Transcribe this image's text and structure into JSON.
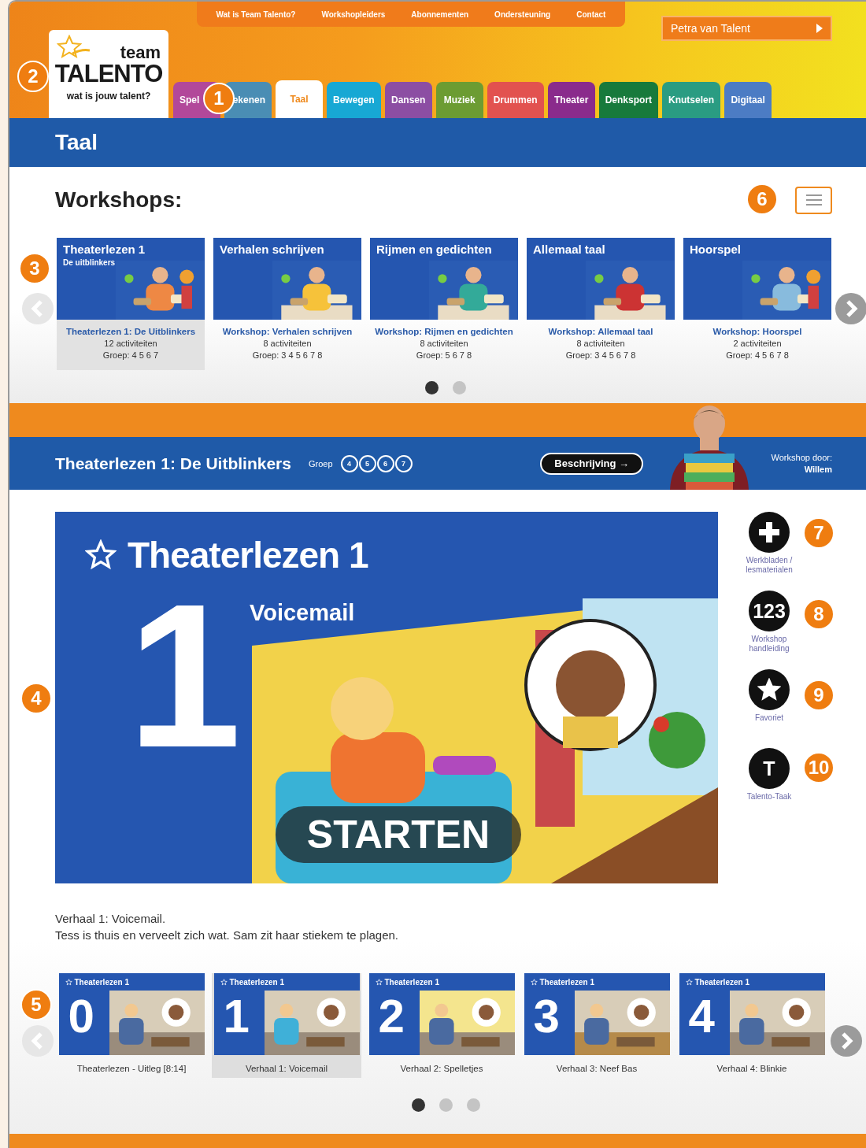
{
  "top_nav": [
    "Wat is Team Talento?",
    "Workshopleiders",
    "Abonnementen",
    "Ondersteuning",
    "Contact"
  ],
  "user_menu": {
    "label": "Petra van Talent"
  },
  "logo": {
    "word1": "team",
    "word2": "TALENTO",
    "tagline": "wat is jouw talent?"
  },
  "tabs": [
    {
      "label": "Spel",
      "color": "#b2489a",
      "selected": false
    },
    {
      "label": "ekenen",
      "color": "#4a8db4",
      "selected": false
    },
    {
      "label": "Taal",
      "color": "#ef8a1e",
      "selected": true
    },
    {
      "label": "Bewegen",
      "color": "#17a8d4",
      "selected": false
    },
    {
      "label": "Dansen",
      "color": "#8c4ea3",
      "selected": false
    },
    {
      "label": "Muziek",
      "color": "#6c9c32",
      "selected": false
    },
    {
      "label": "Drummen",
      "color": "#e2524f",
      "selected": false
    },
    {
      "label": "Theater",
      "color": "#8a2b8c",
      "selected": false
    },
    {
      "label": "Denksport",
      "color": "#177a3c",
      "selected": false
    },
    {
      "label": "Knutselen",
      "color": "#2a9c82",
      "selected": false
    },
    {
      "label": "Digitaal",
      "color": "#4c7cc4",
      "selected": false
    }
  ],
  "section_title": "Taal",
  "workshops": {
    "heading": "Workshops:",
    "prev": {
      "disabled": true
    },
    "next": {
      "disabled": false
    },
    "cards": [
      {
        "title": "Theaterlezen 1",
        "subtitle": "De uitblinkers",
        "name": "Theaterlezen 1: De Uitblinkers",
        "count": "12 activiteiten",
        "groups": "Groep: 4 5 6 7",
        "selected": true
      },
      {
        "title": "Verhalen schrijven",
        "name": "Workshop: Verhalen schrijven",
        "count": "8 activiteiten",
        "groups": "Groep: 3 4 5 6 7 8",
        "selected": false
      },
      {
        "title": "Rijmen en gedichten",
        "name": "Workshop: Rijmen en gedichten",
        "count": "8 activiteiten",
        "groups": "Groep: 5 6 7 8",
        "selected": false
      },
      {
        "title": "Allemaal taal",
        "name": "Workshop: Allemaal taal",
        "count": "8 activiteiten",
        "groups": "Groep: 3 4 5 6 7 8",
        "selected": false
      },
      {
        "title": "Hoorspel",
        "name": "Workshop: Hoorspel",
        "count": "2 activiteiten",
        "groups": "Groep: 4 5 6 7 8",
        "selected": false
      }
    ],
    "dots": [
      {
        "selected": true
      },
      {
        "selected": false
      }
    ]
  },
  "workshop_bar": {
    "title": "Theaterlezen 1: De Uitblinkers",
    "group_label": "Groep",
    "groups": [
      "4",
      "5",
      "6",
      "7"
    ],
    "button": "Beschrijving →",
    "by_label": "Workshop door:",
    "by_name": "Willem"
  },
  "player": {
    "title": "Theaterlezen 1",
    "subtitle": "Voicemail",
    "number": "1",
    "start": "STARTEN"
  },
  "actions": [
    {
      "kind": "plus",
      "label": "Werkbladen / lesmaterialen"
    },
    {
      "kind": "text",
      "glyph": "123",
      "label": "Workshop handleiding"
    },
    {
      "kind": "star",
      "label": "Favoriet"
    },
    {
      "kind": "text",
      "glyph": "T",
      "label": "Talento-Taak"
    }
  ],
  "description": [
    "Verhaal 1: Voicemail.",
    "Tess is thuis en verveelt zich wat. Sam zit haar stiekem te plagen."
  ],
  "lessons": {
    "prev": {
      "disabled": true
    },
    "next": {
      "disabled": false
    },
    "items": [
      {
        "title": "Theaterlezen 1",
        "number": "0",
        "label": "Theaterlezen - Uitleg [8:14]",
        "selected": false
      },
      {
        "title": "Theaterlezen 1",
        "number": "1",
        "label": "Verhaal 1: Voicemail",
        "selected": true
      },
      {
        "title": "Theaterlezen 1",
        "number": "2",
        "label": "Verhaal 2: Spelletjes",
        "selected": false
      },
      {
        "title": "Theaterlezen 1",
        "number": "3",
        "label": "Verhaal 3: Neef Bas",
        "selected": false
      },
      {
        "title": "Theaterlezen 1",
        "number": "4",
        "label": "Verhaal 4: Blinkie",
        "selected": false
      }
    ],
    "dots": [
      {
        "selected": true
      },
      {
        "selected": false
      },
      {
        "selected": false
      }
    ]
  },
  "callouts": [
    "1",
    "2",
    "3",
    "4",
    "5",
    "6",
    "7",
    "8",
    "9",
    "10"
  ]
}
